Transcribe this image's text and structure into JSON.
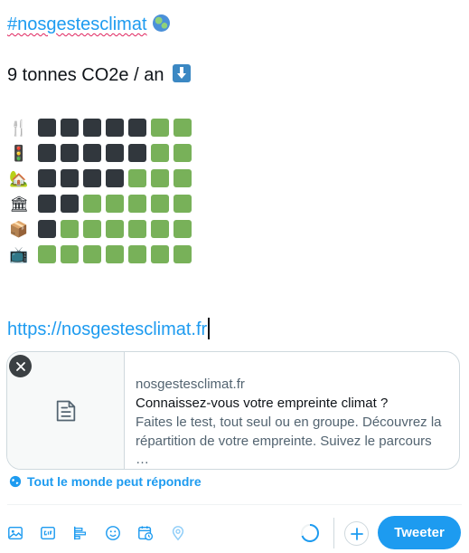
{
  "composer": {
    "hashtag": "#nosgestesclimat",
    "hashtag_emoji": "earth-globe-icon",
    "total": "9 tonnes CO2e / an",
    "total_emoji": "down-arrow-button-icon",
    "url": "https://nosgestesclimat.fr"
  },
  "footprint_grid": {
    "colors": {
      "dark": "#31373d",
      "green": "#78b159"
    },
    "rows": [
      {
        "category_icon": "fork-and-knife-icon",
        "glyph": "🍴",
        "dark": 5,
        "green": 2
      },
      {
        "category_icon": "traffic-light-icon",
        "glyph": "🚦",
        "dark": 5,
        "green": 2
      },
      {
        "category_icon": "house-icon",
        "glyph": "🏡",
        "dark": 4,
        "green": 3
      },
      {
        "category_icon": "classical-building-icon",
        "glyph": "🏛",
        "dark": 2,
        "green": 5
      },
      {
        "category_icon": "package-icon",
        "glyph": "📦",
        "dark": 1,
        "green": 6
      },
      {
        "category_icon": "television-icon",
        "glyph": "📺",
        "dark": 0,
        "green": 7
      }
    ]
  },
  "link_card": {
    "domain": "nosgestesclimat.fr",
    "title": "Connaissez-vous votre empreinte climat ?",
    "description_line1": "Faites le test, tout seul ou en groupe. Découvrez la",
    "description_line2": "répartition de votre empreinte. Suivez le parcours …"
  },
  "reply_setting": {
    "label": "Tout le monde peut répondre"
  },
  "toolbar": {
    "tools": [
      "image-icon",
      "gif-icon",
      "poll-icon",
      "emoji-icon",
      "schedule-icon",
      "location-icon"
    ],
    "tweet_label": "Tweeter"
  },
  "accent_color": "#1d9bf0"
}
